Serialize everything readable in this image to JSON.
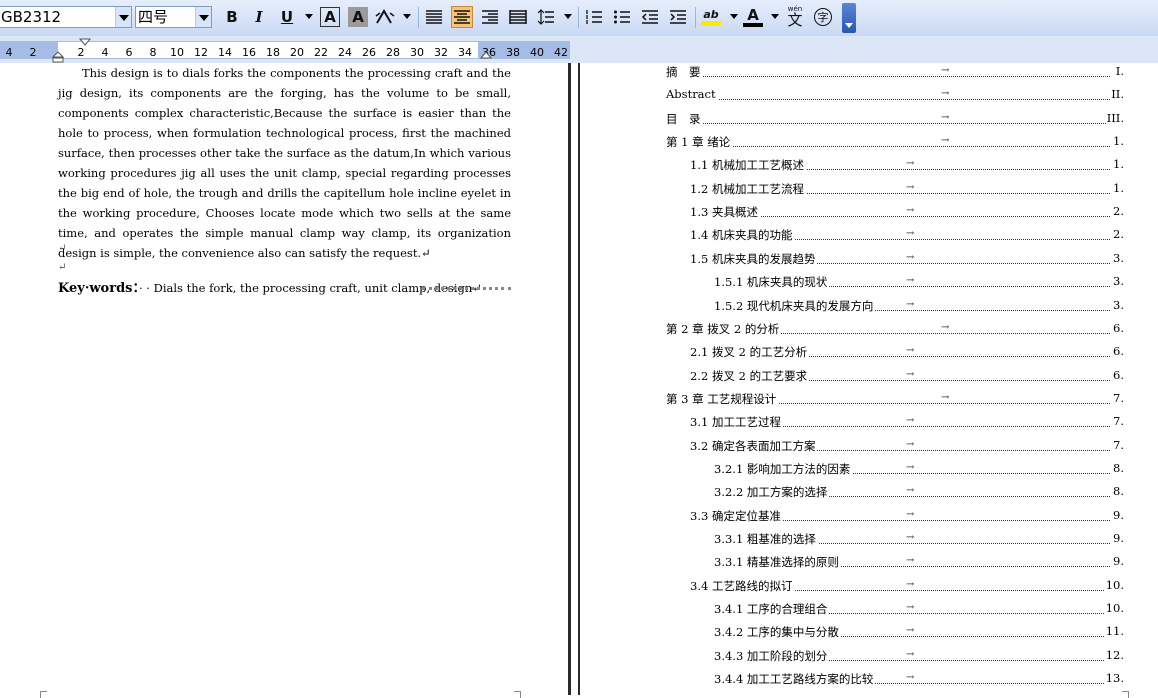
{
  "toolbar": {
    "font_name": "GB2312",
    "font_size": "四号",
    "buttons": [
      {
        "name": "bold-button",
        "label": "B"
      },
      {
        "name": "italic-button",
        "label": "I"
      },
      {
        "name": "underline-button",
        "label": "U"
      }
    ],
    "char_border_label": "A",
    "char_shading_label": "A",
    "font_color_label": "A",
    "highlight_label": "ab",
    "phonetic_label": "文",
    "phonetic_small": "wén",
    "enclose_label": "字",
    "accent_color": "#f7c27a",
    "highlight_color": "#ffe800",
    "font_color": "#000000"
  },
  "ruler": {
    "ticks": [
      "4",
      "2",
      "2",
      "4",
      "6",
      "8",
      "10",
      "12",
      "14",
      "16",
      "18",
      "20",
      "22",
      "24",
      "26",
      "28",
      "30",
      "32",
      "34",
      "36",
      "38",
      "40",
      "42"
    ]
  },
  "document": {
    "abstract_text": "This design is to dials forks the components the processing craft and the jig design, its components are the forging, has the volume to be small, components complex characteristic,Because the surface is easier than the hole to process, when formulation technological process, first the machined surface, then processes other take the surface as the datum,In which various working procedures jig all uses the unit clamp, special regarding processes the big end of hole, the trough and drills the capitellum hole incline eyelet in the working procedure, Chooses locate mode which two sells at the same time, and operates the simple manual clamp way clamp, its organization design is simple, the convenience also can satisfy the request.↵",
    "para_mark": "↵",
    "keywords_label": "Key·words：",
    "keywords_text": "· · Dials the fork, the processing craft, unit clamp, design↵"
  },
  "toc": [
    {
      "label": "摘　要",
      "page": "I.",
      "indent": 0
    },
    {
      "label": "Abstract",
      "page": "II.",
      "indent": 0
    },
    {
      "label": "目　录",
      "page": "III.",
      "indent": 0
    },
    {
      "label": "第 1 章  绪论",
      "page": "1.",
      "indent": 0
    },
    {
      "label": "1.1  机械加工工艺概述",
      "page": "1.",
      "indent": 1
    },
    {
      "label": "1.2 机械加工工艺流程",
      "page": "1.",
      "indent": 1
    },
    {
      "label": "1.3 夹具概述",
      "page": "2.",
      "indent": 1
    },
    {
      "label": "1.4 机床夹具的功能",
      "page": "2.",
      "indent": 1
    },
    {
      "label": "1.5 机床夹具的发展趋势",
      "page": "3.",
      "indent": 1
    },
    {
      "label": "1.5.1 机床夹具的现状",
      "page": "3.",
      "indent": 2
    },
    {
      "label": "1.5.2 现代机床夹具的发展方向",
      "page": "3.",
      "indent": 2
    },
    {
      "label": "第 2 章  拨叉 2 的分析",
      "page": "6.",
      "indent": 0
    },
    {
      "label": "2.1 拨叉 2 的工艺分析",
      "page": "6.",
      "indent": 1
    },
    {
      "label": "2.2 拨叉 2 的工艺要求",
      "page": "6.",
      "indent": 1
    },
    {
      "label": "第 3 章  工艺规程设计",
      "page": "7.",
      "indent": 0
    },
    {
      "label": "3.1  加工工艺过程",
      "page": "7.",
      "indent": 1
    },
    {
      "label": "3.2 确定各表面加工方案",
      "page": "7.",
      "indent": 1
    },
    {
      "label": "3.2.1 影响加工方法的因素",
      "page": "8.",
      "indent": 2
    },
    {
      "label": "3.2.2 加工方案的选择",
      "page": "8.",
      "indent": 2
    },
    {
      "label": "3.3  确定定位基准",
      "page": "9.",
      "indent": 1
    },
    {
      "label": "3.3.1 粗基准的选择",
      "page": "9.",
      "indent": 2
    },
    {
      "label": "3.3.1 精基准选择的原则",
      "page": "9.",
      "indent": 2
    },
    {
      "label": "3.4 工艺路线的拟订",
      "page": "10.",
      "indent": 1
    },
    {
      "label": "3.4.1 工序的合理组合",
      "page": "10.",
      "indent": 2
    },
    {
      "label": "3.4.2 工序的集中与分散",
      "page": "11.",
      "indent": 2
    },
    {
      "label": "3.4.3 加工阶段的划分",
      "page": "12.",
      "indent": 2
    },
    {
      "label": "3.4.4 加工工艺路线方案的比较",
      "page": "13.",
      "indent": 2
    }
  ],
  "tab_arrow": "→"
}
